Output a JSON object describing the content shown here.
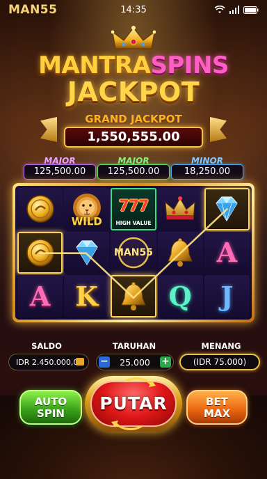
{
  "status_bar": {
    "brand": "MAN55",
    "time": "14:35",
    "icons": [
      "wifi-icon",
      "signal-icon",
      "battery-icon"
    ]
  },
  "logo": {
    "word1": "MANTRA",
    "word2": "SPINS",
    "word3": "JACKPOT"
  },
  "grand_jackpot": {
    "title": "GRAND JACKPOT",
    "value": "1,550,555.00"
  },
  "jackpots": [
    {
      "label": "MAJOR",
      "value": "125,500.00",
      "color": "#b46ae8"
    },
    {
      "label": "MAJOR",
      "value": "125,500.00",
      "color": "#5fd86a"
    },
    {
      "label": "MINOR",
      "value": "18,250.00",
      "color": "#4aa8f0"
    }
  ],
  "reels": {
    "symbols": [
      [
        "gold-coin",
        "lion-wild",
        "seven-high-value",
        "crown",
        "diamond"
      ],
      [
        "gold-coin",
        "diamond",
        "man55-coin",
        "bell",
        "letter-a-pink"
      ],
      [
        "letter-a-pink",
        "letter-k-gold",
        "bell",
        "letter-q-teal",
        "letter-j-blue"
      ]
    ],
    "wild_label": "WILD",
    "seven_label": "777",
    "high_value_label": "HIGH VALUE",
    "coin_label": "MAN55",
    "letters": {
      "a": "A",
      "k": "K",
      "q": "Q",
      "j": "J"
    },
    "highlighted": [
      "r1c0",
      "r2c2",
      "r0c4"
    ]
  },
  "info": {
    "saldo_label": "SALDO",
    "saldo_value": "IDR 2.450.000,00",
    "taruhan_label": "TARUHAN",
    "minus": "−",
    "bet_value": "25.000",
    "plus": "+",
    "menang_label": "MENANG",
    "menang_value": "(IDR 75.000)"
  },
  "buttons": {
    "auto_line1": "AUTO",
    "auto_line2": "SPIN",
    "spin": "PUTAR",
    "bet_max_line1": "BET",
    "bet_max_line2": "MAX"
  },
  "colors": {
    "accent_gold": "#ffd54a",
    "spin_red": "#e01818",
    "auto_green": "#3aa41a",
    "betmax_orange": "#ee6a12"
  }
}
